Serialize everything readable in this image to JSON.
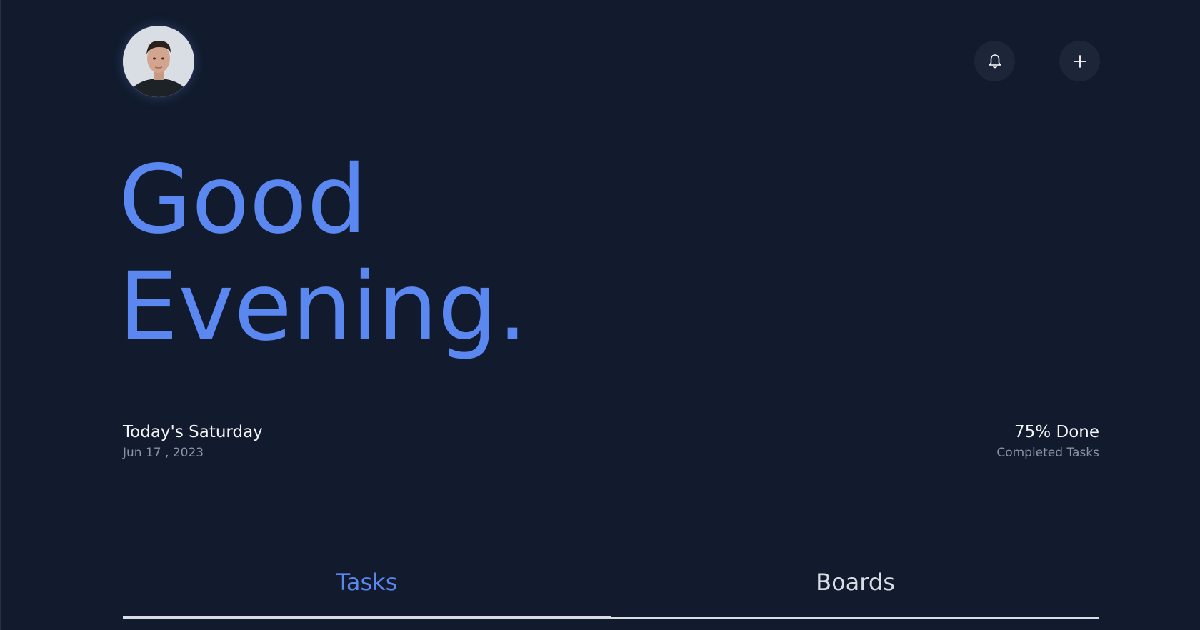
{
  "header": {
    "avatar_alt": "User avatar",
    "notifications_icon": "bell-icon",
    "add_icon": "plus-icon"
  },
  "greeting": {
    "line1": "Good",
    "line2": "Evening."
  },
  "day": {
    "title": "Today's Saturday",
    "date": "Jun 17 , 2023"
  },
  "progress": {
    "title": "75% Done",
    "subtitle": "Completed Tasks"
  },
  "tabs": [
    {
      "label": "Tasks",
      "active": true
    },
    {
      "label": "Boards",
      "active": false
    }
  ],
  "colors": {
    "background": "#111b2d",
    "accent": "#5b87f0",
    "text": "#f2f4f8",
    "muted": "#8a93a3",
    "button_bg": "#1c2638"
  }
}
